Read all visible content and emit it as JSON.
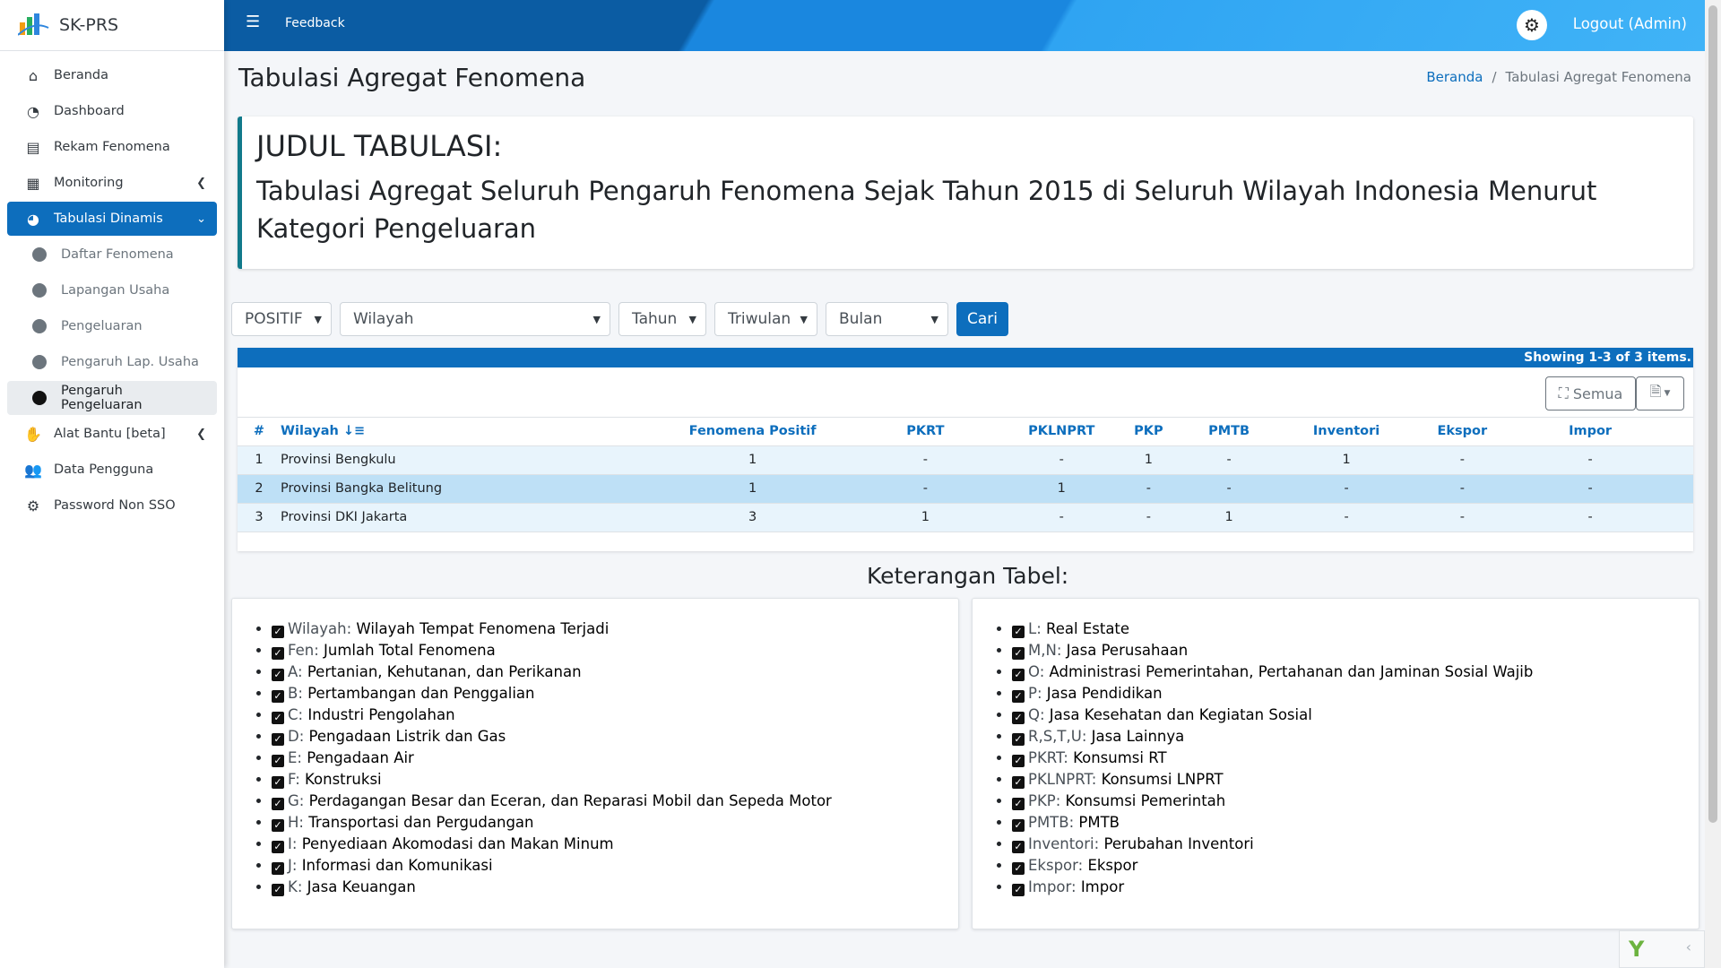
{
  "brand": {
    "name": "SK-PRS"
  },
  "sidebar": {
    "items": [
      {
        "label": "Beranda",
        "icon": "home-icon"
      },
      {
        "label": "Dashboard",
        "icon": "dashboard-icon"
      },
      {
        "label": "Rekam Fenomena",
        "icon": "table-icon"
      },
      {
        "label": "Monitoring",
        "icon": "grid-icon"
      },
      {
        "label": "Tabulasi Dinamis",
        "icon": "pie-chart-icon"
      },
      {
        "label": "Daftar Fenomena"
      },
      {
        "label": "Lapangan Usaha"
      },
      {
        "label": "Pengeluaran"
      },
      {
        "label": "Pengaruh Lap. Usaha"
      },
      {
        "label": "Pengaruh Pengeluaran"
      },
      {
        "label": "Alat Bantu [beta]",
        "icon": "handshake-icon"
      },
      {
        "label": "Data Pengguna",
        "icon": "users-icon"
      },
      {
        "label": "Password Non SSO",
        "icon": "users-gear-icon"
      }
    ]
  },
  "navbar": {
    "feedback": "Feedback",
    "logout": "Logout (Admin)"
  },
  "page": {
    "title": "Tabulasi Agregat Fenomena"
  },
  "breadcrumb": {
    "home": "Beranda",
    "current": "Tabulasi Agregat Fenomena"
  },
  "callout": {
    "heading": "JUDUL TABULASI:",
    "text": "Tabulasi Agregat Seluruh Pengaruh Fenomena Sejak Tahun 2015 di Seluruh Wilayah Indonesia Menurut Kategori Pengeluaran"
  },
  "filters": {
    "jenis": "POSITIF",
    "wilayah": "Wilayah",
    "tahun": "Tahun",
    "triwulan": "Triwulan",
    "bulan": "Bulan",
    "cari": "Cari"
  },
  "grid": {
    "summary_prefix": "Showing ",
    "summary_range": "1-3",
    "summary_mid": " of ",
    "summary_total": "3",
    "summary_suffix": " items.",
    "semua": "Semua",
    "columns": [
      "#",
      "Wilayah",
      "Fenomena Positif",
      "PKRT",
      "PKLNPRT",
      "PKP",
      "PMTB",
      "Inventori",
      "Ekspor",
      "Impor"
    ],
    "rows": [
      [
        "1",
        "Provinsi Bengkulu",
        "1",
        "-",
        "-",
        "1",
        "-",
        "1",
        "-",
        "-"
      ],
      [
        "2",
        "Provinsi Bangka Belitung",
        "1",
        "-",
        "1",
        "-",
        "-",
        "-",
        "-",
        "-"
      ],
      [
        "3",
        "Provinsi DKI Jakarta",
        "3",
        "1",
        "-",
        "-",
        "1",
        "-",
        "-",
        "-"
      ]
    ]
  },
  "keterangan": {
    "title": "Keterangan Tabel:",
    "left": [
      {
        "key": "Wilayah:",
        "val": "Wilayah Tempat Fenomena Terjadi"
      },
      {
        "key": "Fen:",
        "val": "Jumlah Total Fenomena"
      },
      {
        "key": "A:",
        "val": "Pertanian, Kehutanan, dan Perikanan"
      },
      {
        "key": "B:",
        "val": "Pertambangan dan Penggalian"
      },
      {
        "key": "C:",
        "val": "Industri Pengolahan"
      },
      {
        "key": "D:",
        "val": "Pengadaan Listrik dan Gas"
      },
      {
        "key": "E:",
        "val": "Pengadaan Air"
      },
      {
        "key": "F:",
        "val": "Konstruksi"
      },
      {
        "key": "G:",
        "val": "Perdagangan Besar dan Eceran, dan Reparasi Mobil dan Sepeda Motor"
      },
      {
        "key": "H:",
        "val": "Transportasi dan Pergudangan"
      },
      {
        "key": "I:",
        "val": "Penyediaan Akomodasi dan Makan Minum"
      },
      {
        "key": "J:",
        "val": "Informasi dan Komunikasi"
      },
      {
        "key": "K:",
        "val": "Jasa Keuangan"
      }
    ],
    "right": [
      {
        "key": "L:",
        "val": "Real Estate"
      },
      {
        "key": "M,N:",
        "val": "Jasa Perusahaan"
      },
      {
        "key": "O:",
        "val": "Administrasi Pemerintahan, Pertahanan dan Jaminan Sosial Wajib"
      },
      {
        "key": "P:",
        "val": "Jasa Pendidikan"
      },
      {
        "key": "Q:",
        "val": "Jasa Kesehatan dan Kegiatan Sosial"
      },
      {
        "key": "R,S,T,U:",
        "val": "Jasa Lainnya"
      },
      {
        "key": "PKRT:",
        "val": "Konsumsi RT"
      },
      {
        "key": "PKLNPRT:",
        "val": "Konsumsi LNPRT"
      },
      {
        "key": "PKP:",
        "val": "Konsumsi Pemerintah"
      },
      {
        "key": "PMTB:",
        "val": "PMTB"
      },
      {
        "key": "Inventori:",
        "val": "Perubahan Inventori"
      },
      {
        "key": "Ekspor:",
        "val": "Ekspor"
      },
      {
        "key": "Impor:",
        "val": "Impor"
      }
    ]
  },
  "colors": {
    "primary": "#0d6ebd",
    "callout_border": "#117a8b",
    "row_odd": "#e8f4fc",
    "row_even": "#bee0f6"
  }
}
